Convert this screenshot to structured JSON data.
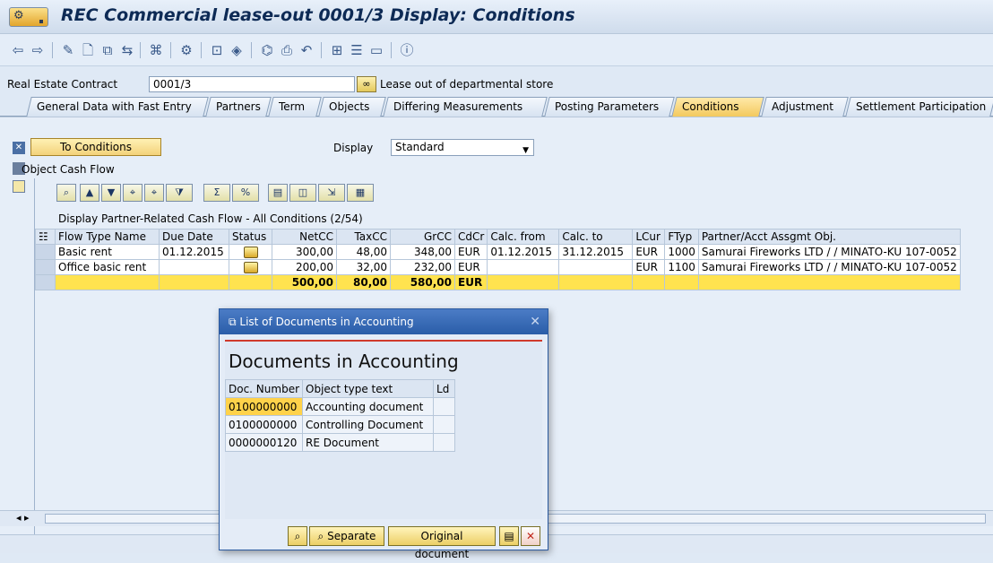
{
  "window": {
    "title": "REC Commercial lease-out 0001/3 Display: Conditions"
  },
  "contract": {
    "label": "Real Estate Contract",
    "value": "0001/3",
    "description": "Lease out of departmental store"
  },
  "tabs": [
    {
      "label": "General Data with Fast Entry"
    },
    {
      "label": "Partners"
    },
    {
      "label": "Term"
    },
    {
      "label": "Objects"
    },
    {
      "label": "Differing Measurements"
    },
    {
      "label": "Posting Parameters"
    },
    {
      "label": "Conditions"
    },
    {
      "label": "Adjustment"
    },
    {
      "label": "Settlement Participation"
    }
  ],
  "conditions": {
    "to_conditions_label": "To Conditions",
    "display_label": "Display",
    "display_value": "Standard",
    "object_cash_flow_label": "Object Cash Flow"
  },
  "grid": {
    "title": "Display Partner-Related Cash Flow - All Conditions (2/54)",
    "headers": {
      "flow_type": "Flow Type Name",
      "due_date": "Due Date",
      "status": "Status",
      "net": "NetCC",
      "tax": "TaxCC",
      "gross": "GrCC",
      "cdcr": "CdCr",
      "calc_from": "Calc. from",
      "calc_to": "Calc. to",
      "lcur": "LCur",
      "ftyp": "FTyp",
      "partner": "Partner/Acct Assgmt Obj."
    },
    "rows": [
      {
        "flow_type": "Basic rent",
        "due_date": "01.12.2015",
        "net": "300,00",
        "tax": "48,00",
        "gross": "348,00",
        "cdcr": "EUR",
        "calc_from": "01.12.2015",
        "calc_to": "31.12.2015",
        "lcur": "EUR",
        "ftyp": "1000",
        "partner": "Samurai Fireworks LTD / / MINATO-KU 107-0052"
      },
      {
        "flow_type": "Office basic rent",
        "due_date": "",
        "net": "200,00",
        "tax": "32,00",
        "gross": "232,00",
        "cdcr": "EUR",
        "calc_from": "",
        "calc_to": "",
        "lcur": "EUR",
        "ftyp": "1100",
        "partner": "Samurai Fireworks LTD / / MINATO-KU 107-0052"
      }
    ],
    "totals": {
      "net": "500,00",
      "tax": "80,00",
      "gross": "580,00",
      "cdcr": "EUR"
    }
  },
  "dialog": {
    "title": "List of Documents in Accounting",
    "heading": "Documents in Accounting",
    "headers": {
      "doc_number": "Doc. Number",
      "object_type": "Object type text",
      "ld": "Ld"
    },
    "rows": [
      {
        "doc_number": "0100000000",
        "object_type": "Accounting document"
      },
      {
        "doc_number": "0100000000",
        "object_type": "Controlling Document"
      },
      {
        "doc_number": "0000000120",
        "object_type": "RE Document"
      }
    ],
    "buttons": {
      "separate": "Separate",
      "original_document": "Original document"
    }
  }
}
